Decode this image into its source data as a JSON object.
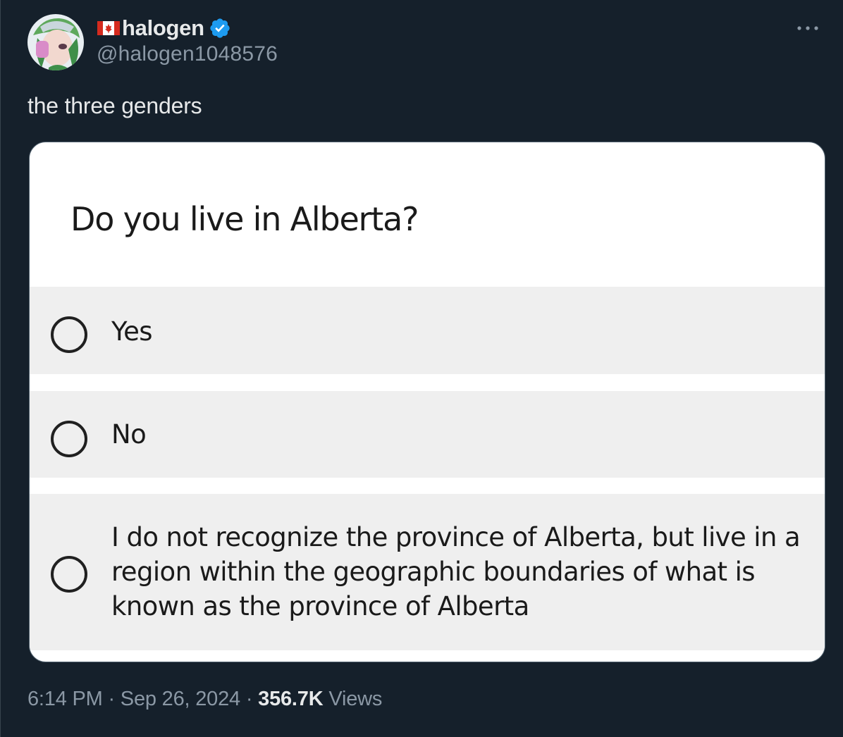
{
  "author": {
    "flag_icon": "canada-flag-icon",
    "display_name": "halogen",
    "verified_icon": "verified-badge-icon",
    "verified_color": "#1d9bf0",
    "handle": "@halogen1048576"
  },
  "more_icon": "more-horizontal-icon",
  "tweet": {
    "text": "the three genders"
  },
  "poll_card": {
    "question": "Do you live in Alberta?",
    "options": [
      {
        "label": "Yes"
      },
      {
        "label": "No"
      },
      {
        "label": "I do not recognize the province of Alberta, but live in a region within the geographic boundaries of what is known as the province of Alberta"
      }
    ]
  },
  "meta": {
    "time": "6:14 PM",
    "separator": "·",
    "date": "Sep 26, 2024",
    "views_count": "356.7K",
    "views_label": "Views"
  },
  "colors": {
    "background": "#15202b",
    "primary_text": "#e7e9ea",
    "secondary_text": "#8b98a5",
    "card_background": "#ffffff",
    "option_background": "#efefef"
  }
}
